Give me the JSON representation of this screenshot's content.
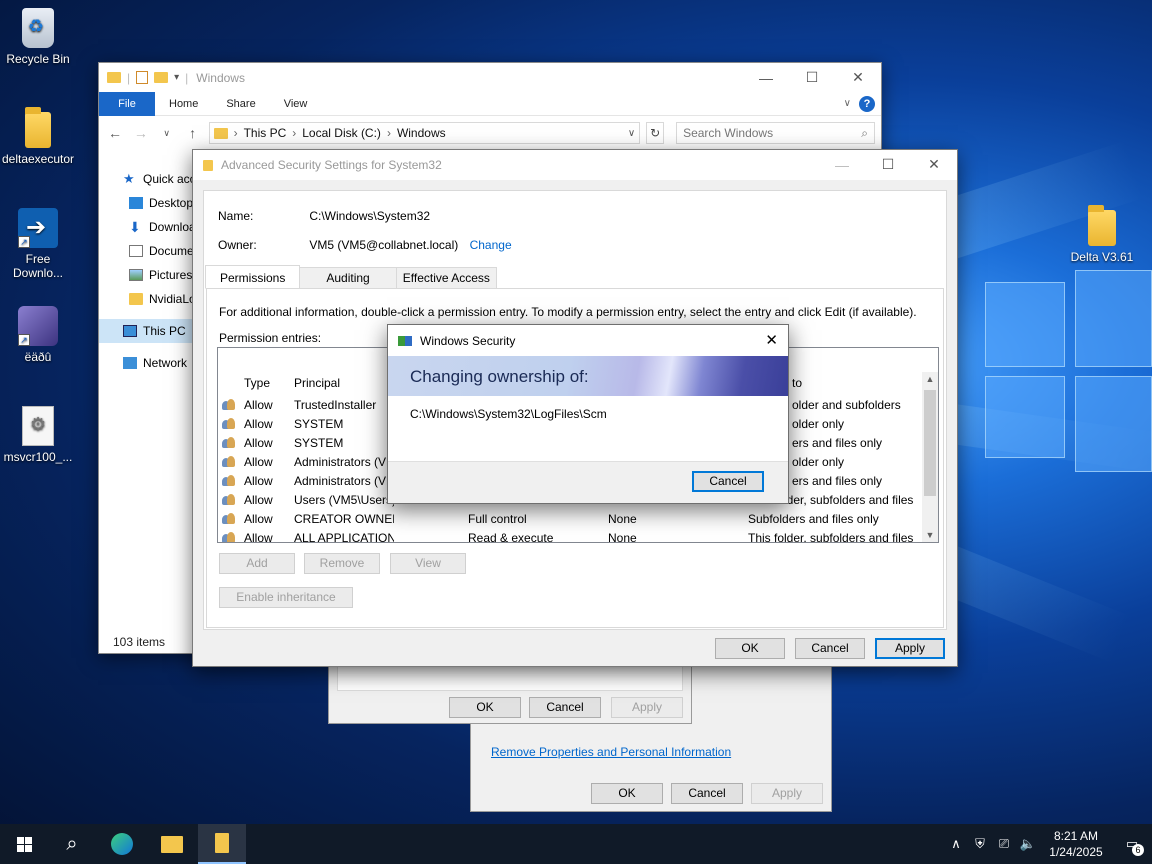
{
  "desktop": {
    "icons": [
      {
        "label": "Recycle Bin"
      },
      {
        "label": "deltaexecutor"
      },
      {
        "label": "Free Downlo..."
      },
      {
        "label": "ëäðû"
      },
      {
        "label": "msvcr100_..."
      },
      {
        "label": "Delta V3.61"
      }
    ]
  },
  "explorer": {
    "title": "Windows",
    "ribbon_tabs": [
      "File",
      "Home",
      "Share",
      "View"
    ],
    "address": [
      "This PC",
      "Local Disk (C:)",
      "Windows"
    ],
    "search_placeholder": "Search Windows",
    "nav": [
      {
        "label": "Quick access"
      },
      {
        "label": "Desktop"
      },
      {
        "label": "Downloads"
      },
      {
        "label": "Documents"
      },
      {
        "label": "Pictures"
      },
      {
        "label": "NvidiaLogs"
      },
      {
        "label": "This PC"
      },
      {
        "label": "Network"
      }
    ],
    "status": "103 items"
  },
  "advanced_security": {
    "title": "Advanced Security Settings for System32",
    "name_label": "Name:",
    "name_value": "C:\\Windows\\System32",
    "owner_label": "Owner:",
    "owner_value": "VM5 (VM5@collabnet.local)",
    "change_link": "Change",
    "tabs": [
      "Permissions",
      "Auditing",
      "Effective Access"
    ],
    "info": "For additional information, double-click a permission entry. To modify a permission entry, select the entry and click Edit (if available).",
    "entries_label": "Permission entries:",
    "columns": {
      "type": "Type",
      "principal": "Principal",
      "applies": "to"
    },
    "rows": [
      {
        "type": "Allow",
        "principal": "TrustedInstaller",
        "access": "",
        "inherited": "",
        "applies": "older and subfolders"
      },
      {
        "type": "Allow",
        "principal": "SYSTEM",
        "access": "",
        "inherited": "",
        "applies": "older only"
      },
      {
        "type": "Allow",
        "principal": "SYSTEM",
        "access": "",
        "inherited": "",
        "applies": "ers and files only"
      },
      {
        "type": "Allow",
        "principal": "Administrators (VM",
        "access": "",
        "inherited": "",
        "applies": "older only"
      },
      {
        "type": "Allow",
        "principal": "Administrators (VM",
        "access": "",
        "inherited": "",
        "applies": "ers and files only"
      },
      {
        "type": "Allow",
        "principal": "Users (VM5\\Users)",
        "access": "Read & execute",
        "inherited": "None",
        "applies": "This folder, subfolders and files"
      },
      {
        "type": "Allow",
        "principal": "CREATOR OWNER",
        "access": "Full control",
        "inherited": "None",
        "applies": "Subfolders and files only"
      },
      {
        "type": "Allow",
        "principal": "ALL APPLICATION PACKAGES",
        "access": "Read & execute",
        "inherited": "None",
        "applies": "This folder, subfolders and files"
      }
    ],
    "buttons": {
      "add": "Add",
      "remove": "Remove",
      "view": "View",
      "inheritance": "Enable inheritance",
      "ok": "OK",
      "cancel": "Cancel",
      "apply": "Apply"
    }
  },
  "background_dialogs": {
    "ok": "OK",
    "cancel": "Cancel",
    "apply": "Apply",
    "remove_link": "Remove Properties and Personal Information"
  },
  "windows_security": {
    "title": "Windows Security",
    "heading": "Changing ownership of:",
    "path": "C:\\Windows\\System32\\LogFiles\\Scm",
    "cancel": "Cancel"
  },
  "taskbar": {
    "time": "8:21 AM",
    "date": "1/24/2025",
    "notification_count": "6"
  }
}
